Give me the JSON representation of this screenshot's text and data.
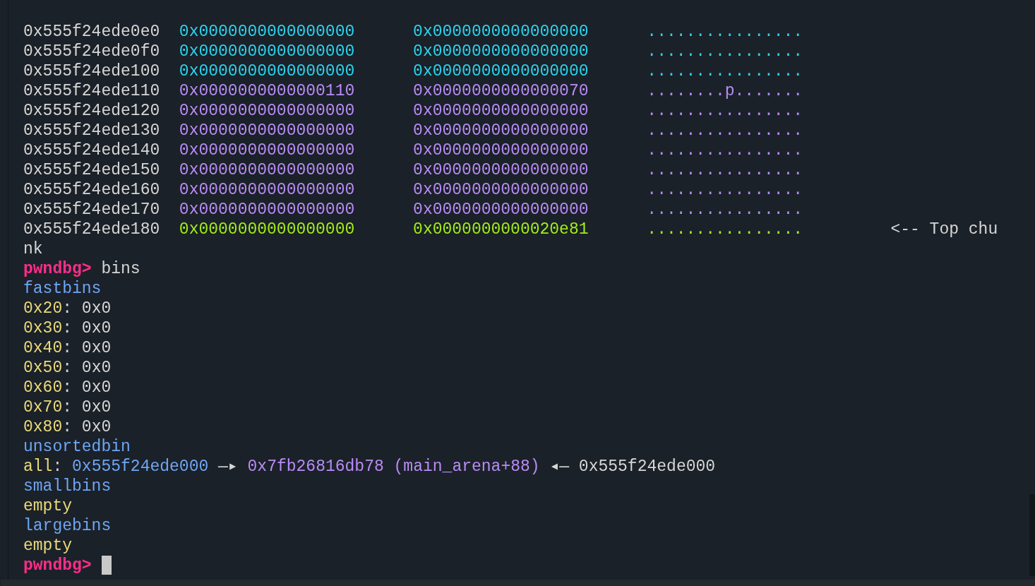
{
  "terminal": {
    "memory_rows": [
      {
        "address": "0x555f24ede0e0",
        "values": [
          "0x0000000000000000",
          "0x0000000000000000"
        ],
        "ascii": "................",
        "color": "#2ad4ef"
      },
      {
        "address": "0x555f24ede0f0",
        "values": [
          "0x0000000000000000",
          "0x0000000000000000"
        ],
        "ascii": "................",
        "color": "#2ad4ef"
      },
      {
        "address": "0x555f24ede100",
        "values": [
          "0x0000000000000000",
          "0x0000000000000000"
        ],
        "ascii": "................",
        "color": "#2ad4ef"
      },
      {
        "address": "0x555f24ede110",
        "values": [
          "0x0000000000000110",
          "0x0000000000000070"
        ],
        "ascii": "........p.......",
        "color": "#b88cf6"
      },
      {
        "address": "0x555f24ede120",
        "values": [
          "0x0000000000000000",
          "0x0000000000000000"
        ],
        "ascii": "................",
        "color": "#b88cf6"
      },
      {
        "address": "0x555f24ede130",
        "values": [
          "0x0000000000000000",
          "0x0000000000000000"
        ],
        "ascii": "................",
        "color": "#b88cf6"
      },
      {
        "address": "0x555f24ede140",
        "values": [
          "0x0000000000000000",
          "0x0000000000000000"
        ],
        "ascii": "................",
        "color": "#b88cf6"
      },
      {
        "address": "0x555f24ede150",
        "values": [
          "0x0000000000000000",
          "0x0000000000000000"
        ],
        "ascii": "................",
        "color": "#b88cf6"
      },
      {
        "address": "0x555f24ede160",
        "values": [
          "0x0000000000000000",
          "0x0000000000000000"
        ],
        "ascii": "................",
        "color": "#b88cf6"
      },
      {
        "address": "0x555f24ede170",
        "values": [
          "0x0000000000000000",
          "0x0000000000000000"
        ],
        "ascii": "................",
        "color": "#b88cf6"
      },
      {
        "address": "0x555f24ede180",
        "values": [
          "0x0000000000000000",
          "0x0000000000020e81"
        ],
        "ascii": "................",
        "color": "#a2ef16",
        "note": "<-- Top chu"
      }
    ],
    "lines": [
      {
        "segments": [
          {
            "kind": "plain",
            "text": "nk"
          }
        ]
      },
      {
        "segments": [
          {
            "kind": "prompt",
            "text": "pwndbg>"
          },
          {
            "kind": "plain",
            "text": " bins"
          }
        ]
      },
      {
        "segments": [
          {
            "kind": "heading",
            "text": "fastbins"
          }
        ]
      },
      {
        "segments": [
          {
            "kind": "label",
            "text": "0x20"
          },
          {
            "kind": "plain",
            "text": ": 0x0"
          }
        ]
      },
      {
        "segments": [
          {
            "kind": "label",
            "text": "0x30"
          },
          {
            "kind": "plain",
            "text": ": 0x0"
          }
        ]
      },
      {
        "segments": [
          {
            "kind": "label",
            "text": "0x40"
          },
          {
            "kind": "plain",
            "text": ": 0x0"
          }
        ]
      },
      {
        "segments": [
          {
            "kind": "label",
            "text": "0x50"
          },
          {
            "kind": "plain",
            "text": ": 0x0"
          }
        ]
      },
      {
        "segments": [
          {
            "kind": "label",
            "text": "0x60"
          },
          {
            "kind": "plain",
            "text": ": 0x0"
          }
        ]
      },
      {
        "segments": [
          {
            "kind": "label",
            "text": "0x70"
          },
          {
            "kind": "plain",
            "text": ": 0x0"
          }
        ]
      },
      {
        "segments": [
          {
            "kind": "label",
            "text": "0x80"
          },
          {
            "kind": "plain",
            "text": ": 0x0"
          }
        ]
      },
      {
        "segments": [
          {
            "kind": "heading",
            "text": "unsortedbin"
          }
        ]
      },
      {
        "segments": [
          {
            "kind": "label",
            "text": "all"
          },
          {
            "kind": "plain",
            "text": ": "
          },
          {
            "kind": "pointer",
            "text": "0x555f24ede000"
          },
          {
            "kind": "plain",
            "text": " —▸ "
          },
          {
            "kind": "symbol",
            "text": "0x7fb26816db78 (main_arena+88)"
          },
          {
            "kind": "plain",
            "text": " ◂— 0x555f24ede000"
          }
        ]
      },
      {
        "segments": [
          {
            "kind": "heading",
            "text": "smallbins"
          }
        ]
      },
      {
        "segments": [
          {
            "kind": "label",
            "text": "empty"
          }
        ]
      },
      {
        "segments": [
          {
            "kind": "heading",
            "text": "largebins"
          }
        ]
      },
      {
        "segments": [
          {
            "kind": "label",
            "text": "empty"
          }
        ]
      },
      {
        "segments": [
          {
            "kind": "prompt",
            "text": "pwndbg>"
          }
        ],
        "cursor": true
      }
    ]
  }
}
